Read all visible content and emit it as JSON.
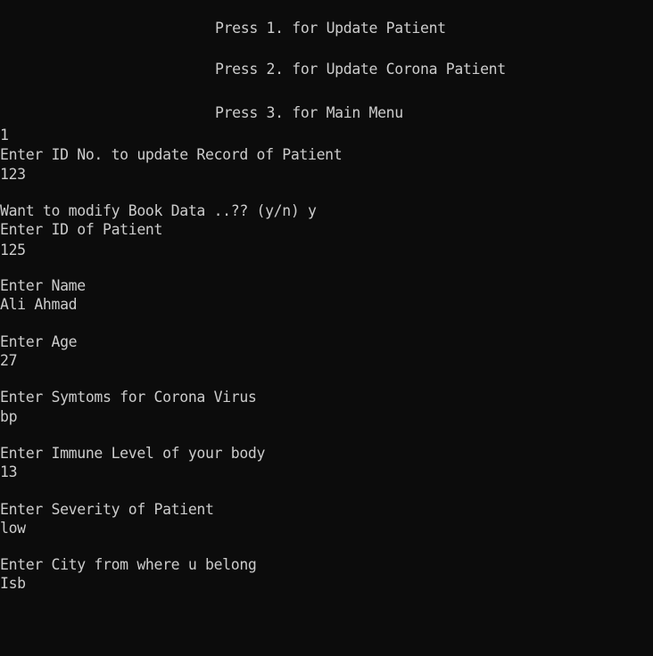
{
  "window": {
    "background": "#0c0c0c",
    "foreground": "#cccccc"
  },
  "console": {
    "menu": {
      "option_1": "Press 1. for Update Patient",
      "option_2": "Press 2. for Update Corona Patient",
      "option_3": "Press 3. for Main Menu"
    },
    "session": {
      "menu_choice": "1",
      "id_prompt": "Enter ID No. to update Record of Patient",
      "id_value": "123",
      "modify_prompt": "Want to modify Book Data ..?? (y/n) y",
      "new_id_prompt": "Enter ID of Patient",
      "new_id_value": "125",
      "name_prompt": "Enter Name",
      "name_value": "Ali Ahmad",
      "age_prompt": "Enter Age",
      "age_value": "27",
      "symptoms_prompt": "Enter Symtoms for Corona Virus",
      "symptoms_value": "bp",
      "immune_prompt": "Enter Immune Level of your body",
      "immune_value": "13",
      "severity_prompt": "Enter Severity of Patient",
      "severity_value": "low",
      "city_prompt": "Enter City from where u belong",
      "city_value": "Isb"
    }
  }
}
